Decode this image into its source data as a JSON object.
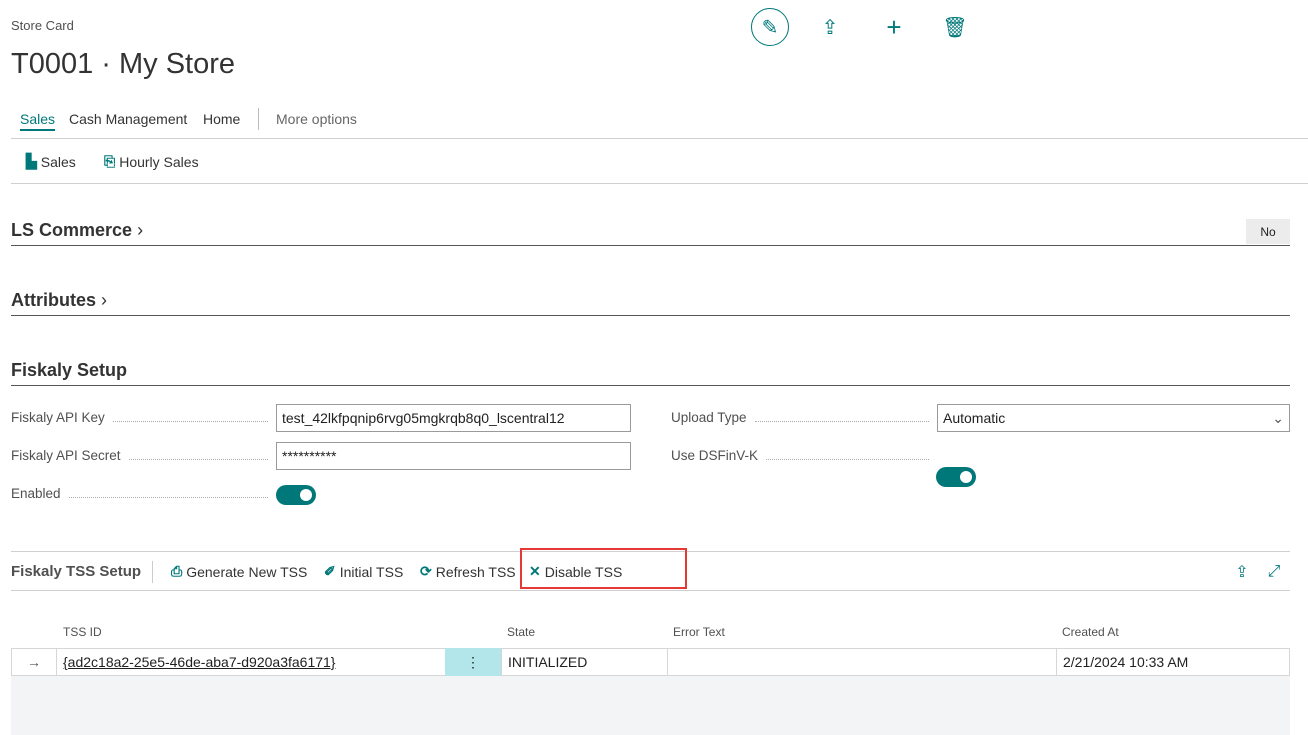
{
  "header": {
    "caption": "Store Card",
    "title": "T0001 · My Store"
  },
  "tabs": [
    {
      "label": "Sales"
    },
    {
      "label": "Cash Management"
    },
    {
      "label": "Home"
    },
    {
      "label": "More options"
    }
  ],
  "actions": [
    {
      "label": "Sales"
    },
    {
      "label": "Hourly Sales"
    }
  ],
  "sections": {
    "ls_commerce": "LS Commerce",
    "ls_value": "No",
    "attributes": "Attributes",
    "fiskaly": "Fiskaly Setup"
  },
  "fields": {
    "api_key_label": "Fiskaly API Key",
    "api_key": "test_42lkfpqnip6rvg05mgkrqb8q0_lscentral12",
    "api_secret_label": "Fiskaly API Secret",
    "api_secret": "**********",
    "enabled_label": "Enabled",
    "enabled": true,
    "upload_type_label": "Upload Type",
    "upload_type": "Automatic",
    "dsfinv_label": "Use DSFinV-K",
    "dsfinv": true
  },
  "tss": {
    "title": "Fiskaly TSS Setup",
    "actions": [
      "Generate New TSS",
      "Initial TSS",
      "Refresh TSS",
      "Disable TSS"
    ],
    "columns": [
      "TSS ID",
      "State",
      "Error Text",
      "Created At"
    ],
    "rows": [
      {
        "id": "{ad2c18a2-25e5-46de-aba7-d920a3fa6171}",
        "state": "INITIALIZED",
        "error": "",
        "created": "2/21/2024 10:33 AM"
      }
    ]
  },
  "colors": {
    "accent": "#00787a",
    "highlight": "#e53935"
  }
}
